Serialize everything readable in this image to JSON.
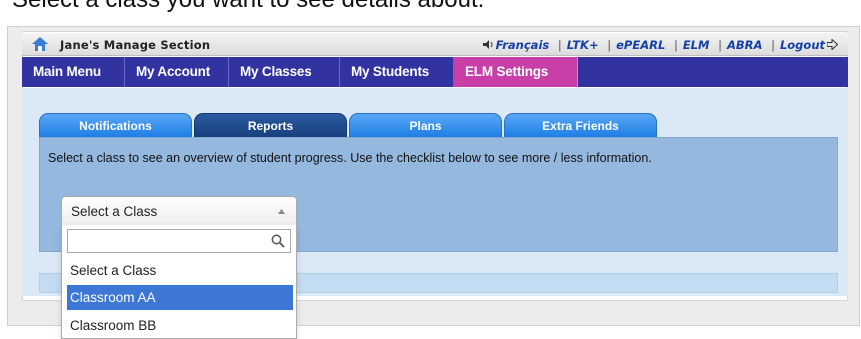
{
  "caption": "Select a class you want to see details about.",
  "topbar": {
    "title": "Jane's Manage Section",
    "links": [
      "Français",
      "LTK+",
      "ePEARL",
      "ELM",
      "ABRA",
      "Logout"
    ],
    "separator": "|"
  },
  "nav": {
    "items": [
      "Main Menu",
      "My Account",
      "My Classes",
      "My Students",
      "ELM Settings"
    ],
    "active_index": 4
  },
  "tabs": {
    "items": [
      "Notifications",
      "Reports",
      "Plans",
      "Extra Friends"
    ],
    "active_index": 1
  },
  "intro_text": "Select a class to see an overview of student progress. Use the checklist below to see more / less information.",
  "class_select": {
    "selected": "Select a Class",
    "search_value": "",
    "options": [
      "Select a Class",
      "Classroom AA",
      "Classroom BB"
    ],
    "highlighted_index": 1
  },
  "colors": {
    "nav_bg": "#3232a0",
    "nav_active": "#c83fa8",
    "tab_blue": "#1e7ee6",
    "tab_active": "#17407e",
    "tab_body": "#95b8df",
    "option_highlight": "#3d77d6",
    "link": "#1540a8"
  },
  "icons": {
    "home": "home-icon",
    "speaker": "speaker-icon",
    "logout": "logout-arrow-icon",
    "caret": "caret-up-icon",
    "search": "search-icon"
  }
}
